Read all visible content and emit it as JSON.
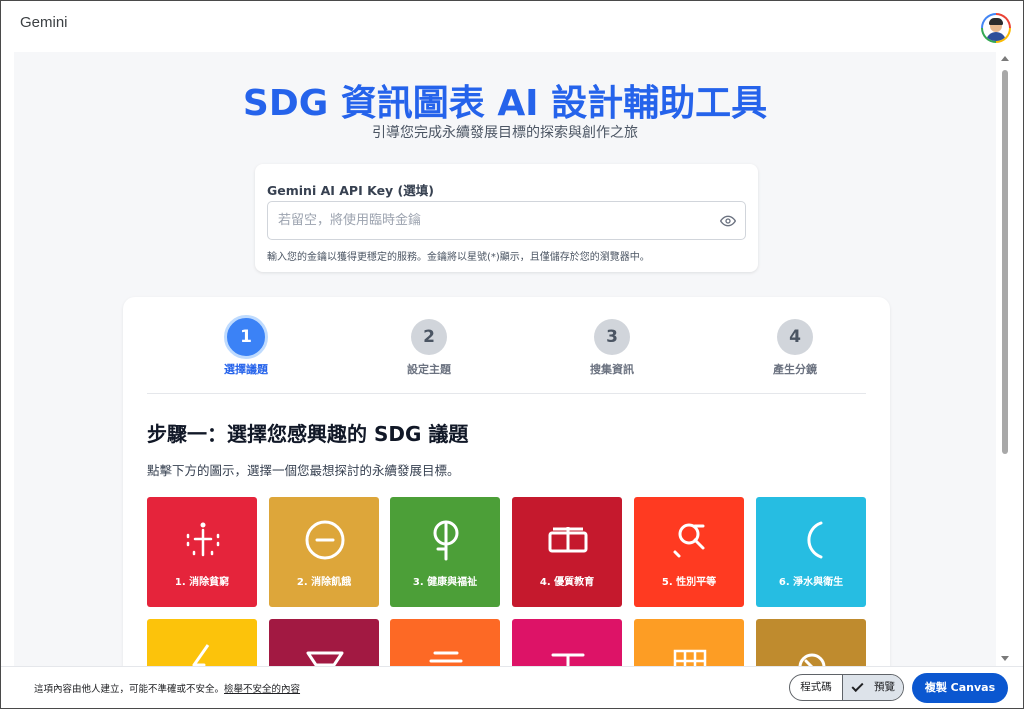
{
  "app": {
    "title": "Gemini"
  },
  "header": {
    "title": "SDG 資訊圖表 AI 設計輔助工具",
    "subtitle": "引導您完成永續發展目標的探索與創作之旅"
  },
  "api": {
    "label": "Gemini AI API Key (選填)",
    "placeholder": "若留空，將使用臨時金鑰",
    "value": "",
    "hint": "輸入您的金鑰以獲得更穩定的服務。金鑰將以星號(*)顯示，且僅儲存於您的瀏覽器中。"
  },
  "steps": [
    {
      "number": "1",
      "label": "選擇議題",
      "active": true
    },
    {
      "number": "2",
      "label": "設定主題",
      "active": false
    },
    {
      "number": "3",
      "label": "搜集資訊",
      "active": false
    },
    {
      "number": "4",
      "label": "產生分鏡",
      "active": false
    }
  ],
  "section": {
    "heading": "步驟一：選擇您感興趣的 SDG 議題",
    "description": "點擊下方的圖示，選擇一個您最想探討的永續發展目標。"
  },
  "goals": [
    {
      "label": "1. 消除貧窮",
      "color": "#e5243b",
      "icon": "people-icon"
    },
    {
      "label": "2. 消除飢餓",
      "color": "#dda63a",
      "icon": "bowl-icon"
    },
    {
      "label": "3. 健康與福祉",
      "color": "#4c9f38",
      "icon": "heartbeat-icon"
    },
    {
      "label": "4. 優質教育",
      "color": "#c5192d",
      "icon": "book-icon"
    },
    {
      "label": "5. 性別平等",
      "color": "#ff3a21",
      "icon": "gender-icon"
    },
    {
      "label": "6. 淨水與衛生",
      "color": "#26bde2",
      "icon": "water-icon"
    },
    {
      "label": "",
      "color": "#fcc30b",
      "icon": "energy-icon"
    },
    {
      "label": "",
      "color": "#a21942",
      "icon": "growth-icon"
    },
    {
      "label": "",
      "color": "#fd6925",
      "icon": "infrastructure-icon"
    },
    {
      "label": "",
      "color": "#dd1367",
      "icon": "equality-icon"
    },
    {
      "label": "",
      "color": "#fd9d24",
      "icon": "city-icon"
    },
    {
      "label": "",
      "color": "#bf8b2e",
      "icon": "consumption-icon"
    }
  ],
  "footer": {
    "notice": "這項內容由他人建立，可能不準確或不安全。",
    "report_link": "檢舉不安全的內容",
    "code_label": "程式碼",
    "preview_label": "預覽",
    "copy_label": "複製 Canvas"
  }
}
